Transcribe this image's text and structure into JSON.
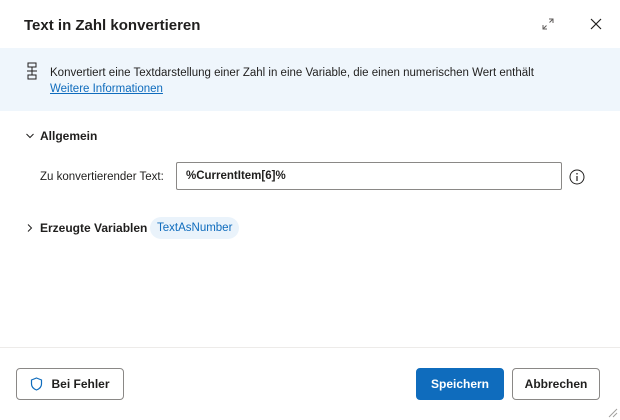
{
  "dialog": {
    "title": "Text in Zahl konvertieren",
    "expand_icon": "expand-arrows-icon",
    "close_icon": "close-icon"
  },
  "banner": {
    "icon": "action-icon",
    "description": "Konvertiert eine Textdarstellung einer Zahl in eine Variable, die einen numerischen Wert enthält",
    "link_text": "Weitere Informationen"
  },
  "general": {
    "section_label": "Allgemein",
    "expanded": true,
    "field_label": "Zu konvertierender Text:",
    "field_value": "%CurrentItem[6]%",
    "info_icon": "info-icon"
  },
  "variables": {
    "section_label": "Erzeugte Variablen",
    "expanded": false,
    "chip": "TextAsNumber"
  },
  "footer": {
    "error_button": "Bei Fehler",
    "error_icon": "shield-icon",
    "save_button": "Speichern",
    "cancel_button": "Abbrechen"
  },
  "colors": {
    "accent": "#0f6cbd",
    "banner_bg": "#eff6fc",
    "chip_bg": "#eaf3fb"
  }
}
